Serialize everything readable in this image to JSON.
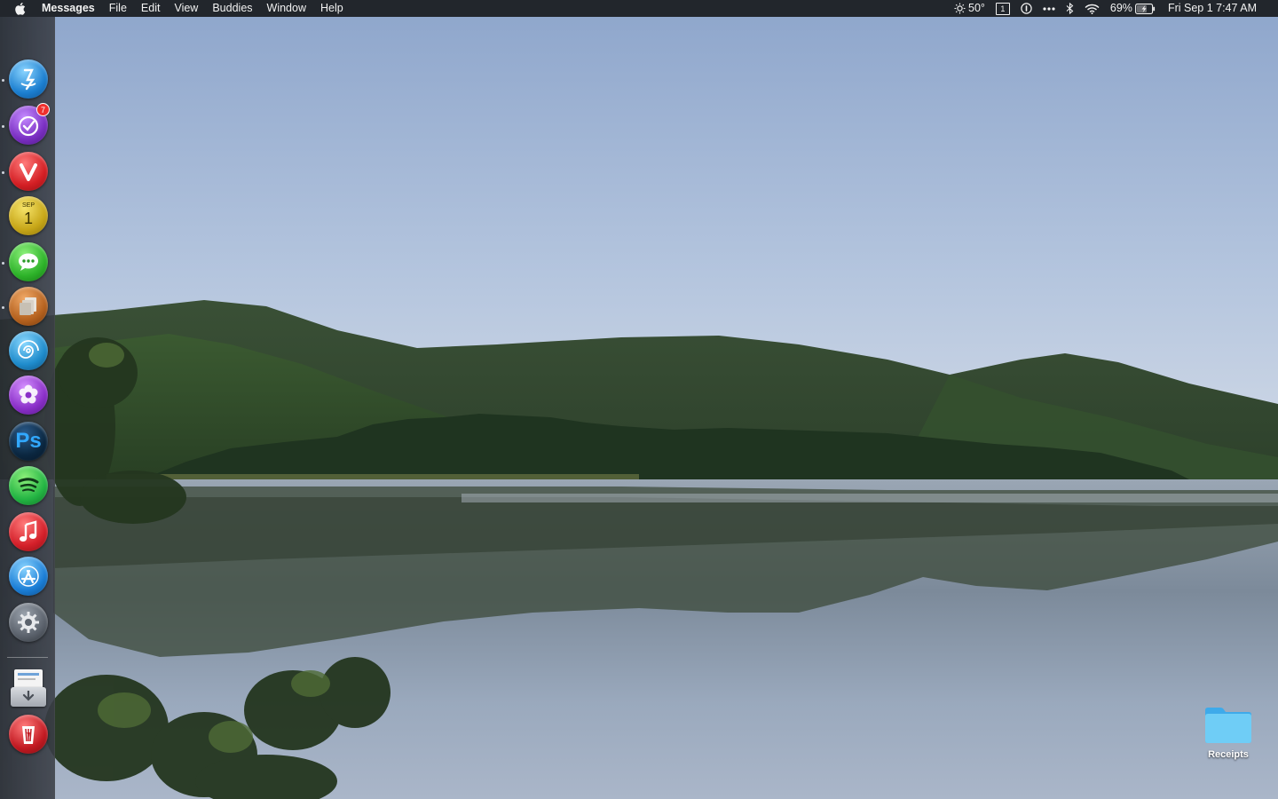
{
  "menubar": {
    "app_name": "Messages",
    "menus": [
      "File",
      "Edit",
      "View",
      "Buddies",
      "Window",
      "Help"
    ],
    "status": {
      "weather": "50°",
      "spaces": "1",
      "battery": "69%",
      "clock": "Fri Sep 1  7:47 AM"
    }
  },
  "dock": {
    "items": [
      {
        "name": "finder",
        "running": true
      },
      {
        "name": "timer-app",
        "running": true,
        "badge": "7"
      },
      {
        "name": "vivaldi",
        "running": true
      },
      {
        "name": "calendar",
        "running": false,
        "month": "SEP",
        "day": "1"
      },
      {
        "name": "messages",
        "running": true
      },
      {
        "name": "file-stack-app",
        "running": true
      },
      {
        "name": "nautilus-app",
        "running": false
      },
      {
        "name": "flower-app",
        "running": false
      },
      {
        "name": "photoshop",
        "running": false,
        "label": "Ps"
      },
      {
        "name": "spotify",
        "running": false
      },
      {
        "name": "music",
        "running": false
      },
      {
        "name": "app-store",
        "running": false
      },
      {
        "name": "system-preferences",
        "running": false
      },
      {
        "name": "downloads",
        "running": false
      },
      {
        "name": "trash-app",
        "running": false
      }
    ]
  },
  "desktop": {
    "folder_label": "Receipts"
  },
  "colors": {
    "menubar_bg": "#1c1e22",
    "dock_bg": "#2c3036",
    "folder_blue": "#5ec4f4",
    "badge_red": "#f0302e"
  }
}
